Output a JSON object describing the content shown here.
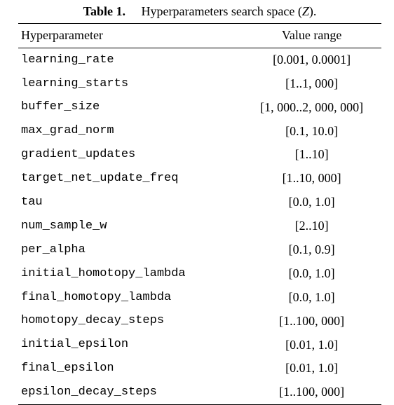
{
  "caption": {
    "label": "Table 1.",
    "text_before": "Hyperparameters search space (",
    "text_var": "Z",
    "text_after": ")."
  },
  "table": {
    "header": {
      "name": "Hyperparameter",
      "range": "Value range"
    },
    "rows": [
      {
        "name": "learning_rate",
        "range": "[0.001, 0.0001]"
      },
      {
        "name": "learning_starts",
        "range": "[1..1, 000]"
      },
      {
        "name": "buffer_size",
        "range": "[1, 000..2, 000, 000]"
      },
      {
        "name": "max_grad_norm",
        "range": "[0.1, 10.0]"
      },
      {
        "name": "gradient_updates",
        "range": "[1..10]"
      },
      {
        "name": "target_net_update_freq",
        "range": "[1..10, 000]"
      },
      {
        "name": "tau",
        "range": "[0.0, 1.0]"
      },
      {
        "name": "num_sample_w",
        "range": "[2..10]"
      },
      {
        "name": "per_alpha",
        "range": "[0.1, 0.9]"
      },
      {
        "name": "initial_homotopy_lambda",
        "range": "[0.0, 1.0]"
      },
      {
        "name": "final_homotopy_lambda",
        "range": "[0.0, 1.0]"
      },
      {
        "name": "homotopy_decay_steps",
        "range": "[1..100, 000]"
      },
      {
        "name": "initial_epsilon",
        "range": "[0.01, 1.0]"
      },
      {
        "name": "final_epsilon",
        "range": "[0.01, 1.0]"
      },
      {
        "name": "epsilon_decay_steps",
        "range": "[1..100, 000]"
      }
    ]
  },
  "chart_data": {
    "type": "table",
    "title": "Table 1. Hyperparameters search space (Z).",
    "columns": [
      "Hyperparameter",
      "Value range"
    ],
    "rows": [
      [
        "learning_rate",
        "[0.001, 0.0001]"
      ],
      [
        "learning_starts",
        "[1..1,000]"
      ],
      [
        "buffer_size",
        "[1,000..2,000,000]"
      ],
      [
        "max_grad_norm",
        "[0.1, 10.0]"
      ],
      [
        "gradient_updates",
        "[1..10]"
      ],
      [
        "target_net_update_freq",
        "[1..10,000]"
      ],
      [
        "tau",
        "[0.0, 1.0]"
      ],
      [
        "num_sample_w",
        "[2..10]"
      ],
      [
        "per_alpha",
        "[0.1, 0.9]"
      ],
      [
        "initial_homotopy_lambda",
        "[0.0, 1.0]"
      ],
      [
        "final_homotopy_lambda",
        "[0.0, 1.0]"
      ],
      [
        "homotopy_decay_steps",
        "[1..100,000]"
      ],
      [
        "initial_epsilon",
        "[0.01, 1.0]"
      ],
      [
        "final_epsilon",
        "[0.01, 1.0]"
      ],
      [
        "epsilon_decay_steps",
        "[1..100,000]"
      ]
    ]
  }
}
